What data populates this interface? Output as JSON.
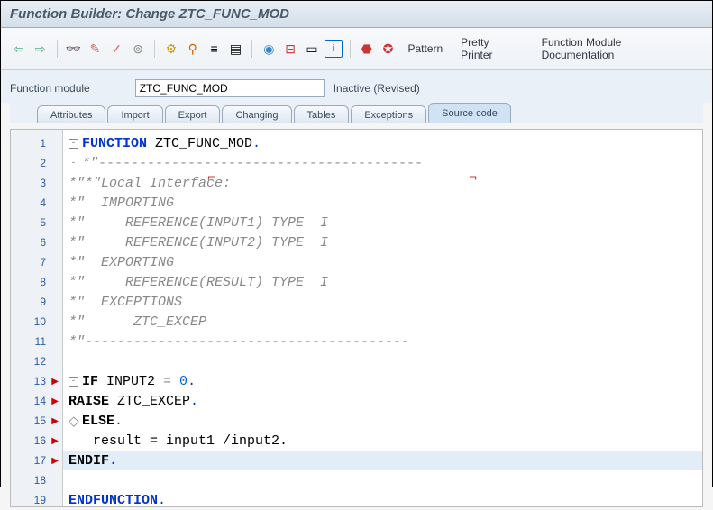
{
  "header": {
    "title": "Function Builder: Change ZTC_FUNC_MOD"
  },
  "toolbar": {
    "pattern": "Pattern",
    "pretty": "Pretty Printer",
    "docs": "Function Module Documentation"
  },
  "info": {
    "label": "Function module",
    "value": "ZTC_FUNC_MOD",
    "status": "Inactive (Revised)"
  },
  "tabs": {
    "attributes": "Attributes",
    "import": "Import",
    "export": "Export",
    "changing": "Changing",
    "tables": "Tables",
    "exceptions": "Exceptions",
    "source": "Source code"
  },
  "lines": {
    "l1": {
      "n": "1"
    },
    "l2": {
      "n": "2"
    },
    "l3": {
      "n": "3"
    },
    "l4": {
      "n": "4"
    },
    "l5": {
      "n": "5"
    },
    "l6": {
      "n": "6"
    },
    "l7": {
      "n": "7"
    },
    "l8": {
      "n": "8"
    },
    "l9": {
      "n": "9"
    },
    "l10": {
      "n": "10"
    },
    "l11": {
      "n": "11"
    },
    "l12": {
      "n": "12"
    },
    "l13": {
      "n": "13"
    },
    "l14": {
      "n": "14"
    },
    "l15": {
      "n": "15"
    },
    "l16": {
      "n": "16"
    },
    "l17": {
      "n": "17"
    },
    "l18": {
      "n": "18"
    },
    "l19": {
      "n": "19"
    }
  },
  "code": {
    "l1_kw": "FUNCTION",
    "l1_name": " ZTC_FUNC_MOD",
    "l1_dot": ".",
    "l2": "*\"----------------------------------------",
    "l3": "*\"*\"Local Interface:",
    "l4": "*\"  IMPORTING",
    "l5": "*\"     REFERENCE(INPUT1) TYPE  I",
    "l6": "*\"     REFERENCE(INPUT2) TYPE  I",
    "l7": "*\"  EXPORTING",
    "l8": "*\"     REFERENCE(RESULT) TYPE  I",
    "l9": "*\"  EXCEPTIONS",
    "l10": "*\"      ZTC_EXCEP",
    "l11": "*\"----------------------------------------",
    "l13_if": "IF",
    "l13_cond": " INPUT2 ",
    "l13_eq": "= ",
    "l13_zero": "0",
    "l13_dot": ".",
    "l14_raise": "RAISE",
    "l14_name": " ZTC_EXCEP",
    "l14_dot": ".",
    "l15_else": "ELSE",
    "l15_dot": ".",
    "l16": "   result = input1 /input2.",
    "l17_endif": "ENDIF",
    "l17_dot": ".",
    "l19_endf": "ENDFUNCTION",
    "l19_dot": "."
  }
}
